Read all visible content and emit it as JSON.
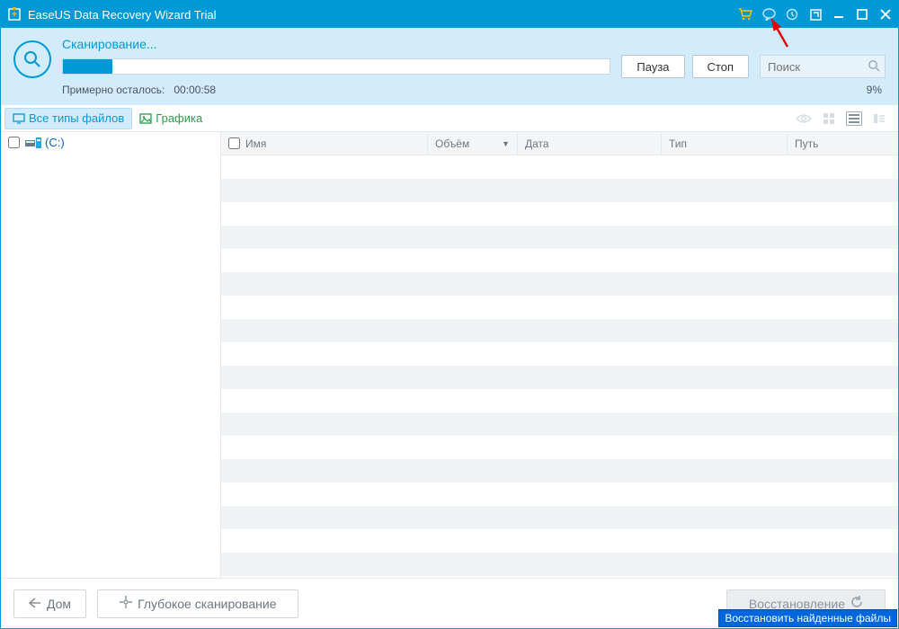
{
  "title": "EaseUS Data Recovery Wizard Trial",
  "scan": {
    "label": "Сканирование...",
    "time_label": "Примерно осталось:",
    "time_value": "00:00:58",
    "percent": "9%",
    "pause": "Пауза",
    "stop": "Стоп"
  },
  "search": {
    "placeholder": "Поиск"
  },
  "filters": {
    "all": "Все типы файлов",
    "graphics": "Графика"
  },
  "tree": {
    "drive": "(C:)"
  },
  "columns": {
    "name": "Имя",
    "volume": "Объём",
    "date": "Дата",
    "type": "Тип",
    "path": "Путь"
  },
  "footer": {
    "home": "Дом",
    "deep": "Глубокое сканирование",
    "recover": "Восстановление"
  },
  "tooltip": "Восстановить найденные файлы"
}
